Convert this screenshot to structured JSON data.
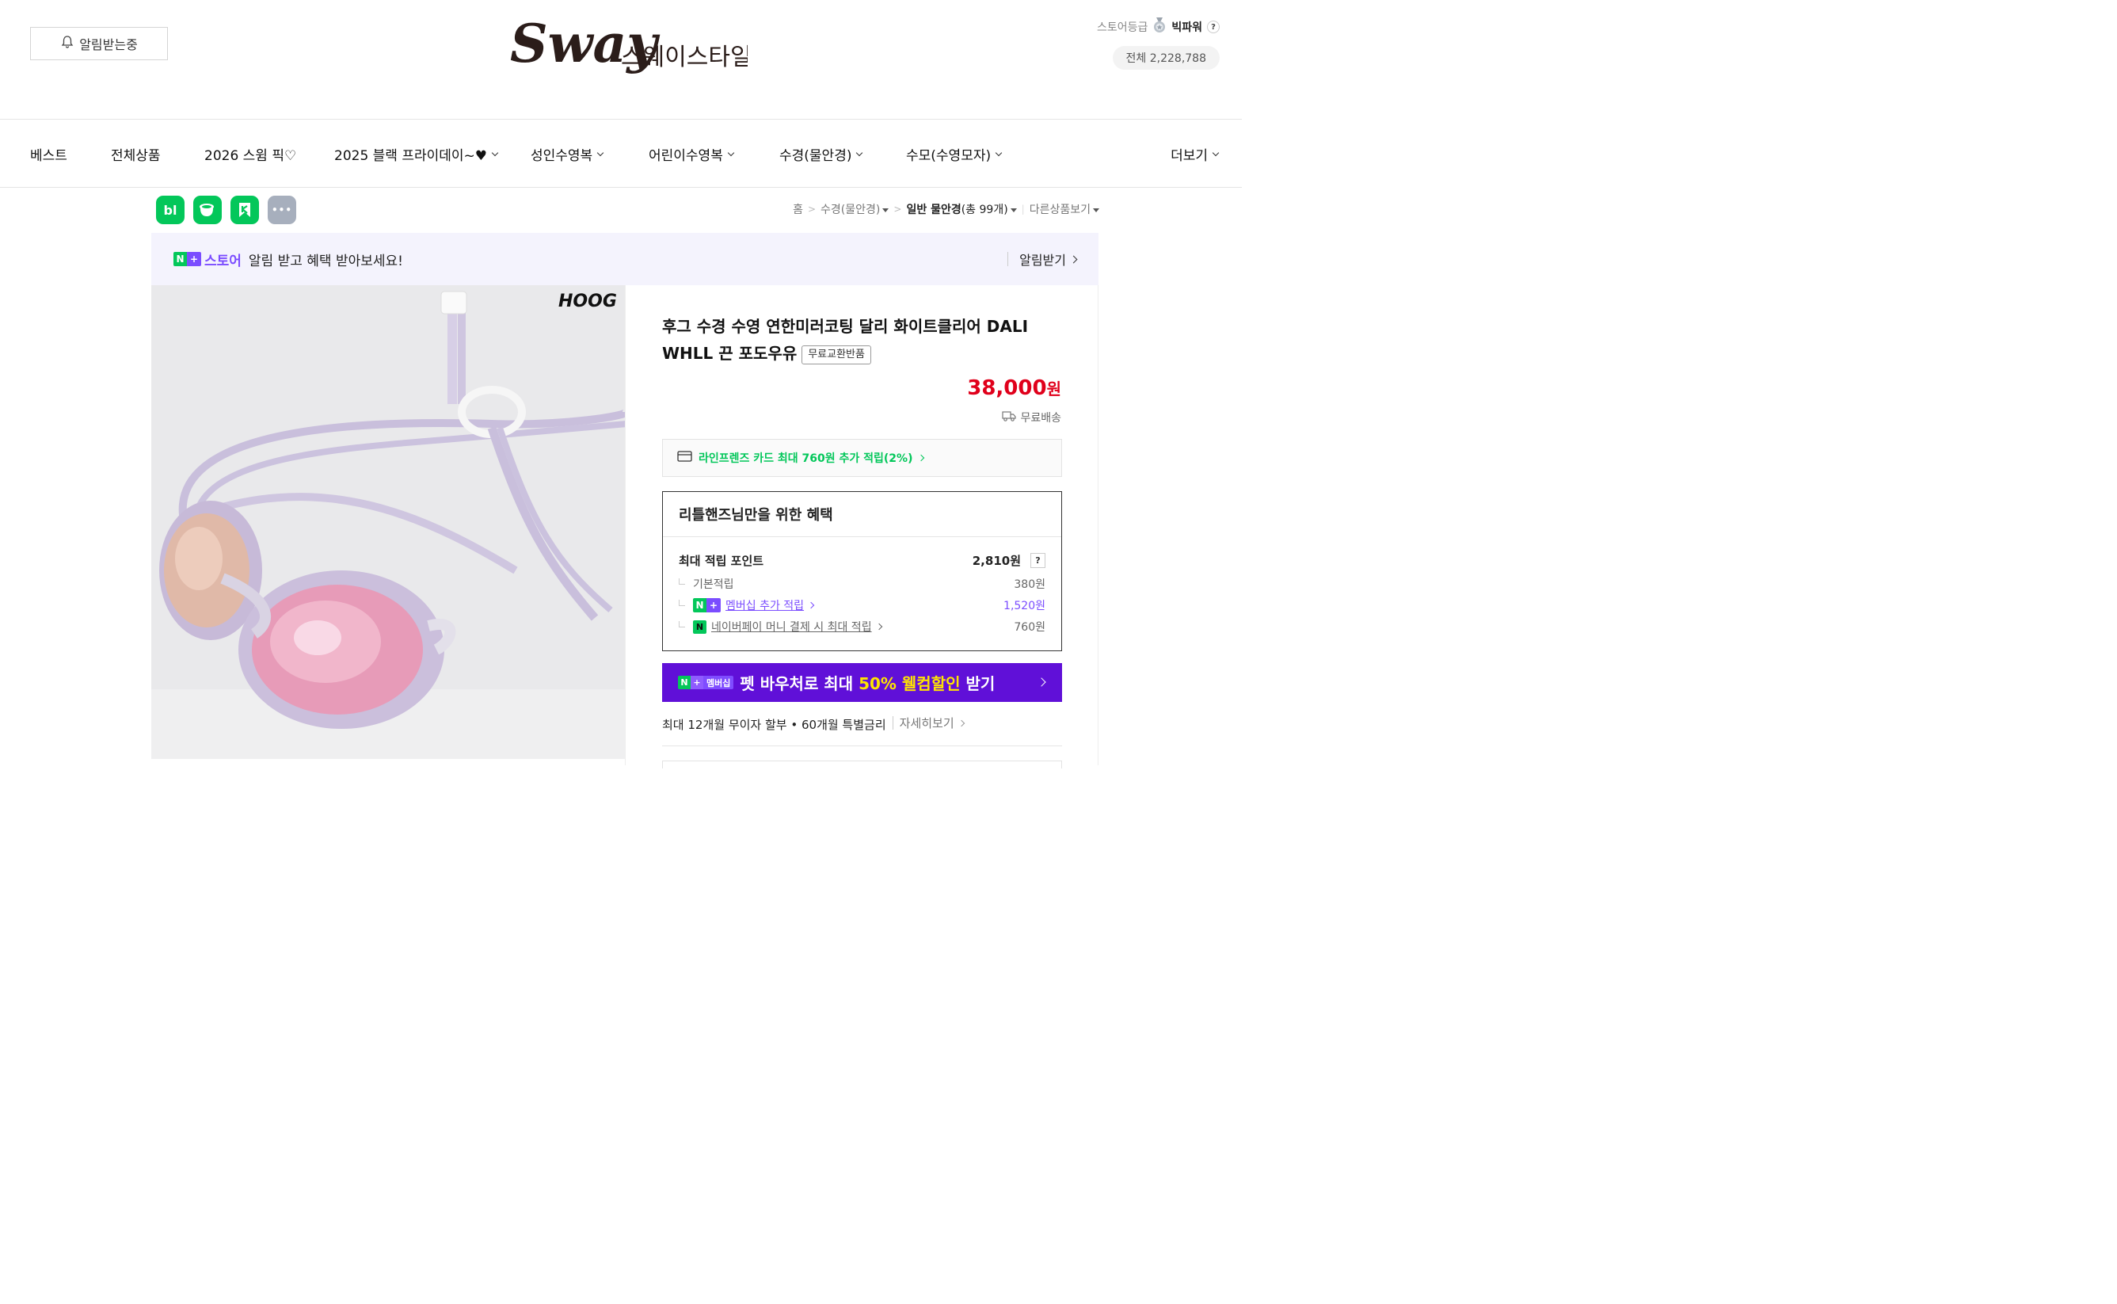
{
  "header": {
    "alarm_button": "알림받는중",
    "logo_text": "Sway",
    "logo_korean": "스웨이스타일",
    "store_grade_label": "스토어등급",
    "store_grade_name": "빅파워",
    "help": "?",
    "total_visits": "전체 2,228,788"
  },
  "nav": {
    "items": [
      {
        "label": "베스트"
      },
      {
        "label": "전체상품"
      },
      {
        "label": "2026 스윔 픽♡"
      },
      {
        "label": "2025 블랙 프라이데이~♥"
      },
      {
        "label": "성인수영복"
      },
      {
        "label": "어린이수영복"
      },
      {
        "label": "수경(물안경)"
      },
      {
        "label": "수모(수영모자)"
      }
    ],
    "more": "더보기"
  },
  "share": {
    "icons": [
      "blog-icon",
      "cafe-icon",
      "keep-icon",
      "more-icon"
    ],
    "blog": "bl",
    "more": "•••"
  },
  "breadcrumb": {
    "home": "홈",
    "level1": "수경(물안경)",
    "level2_prefix": "일반 물안경",
    "level2_count": "(총 99개)",
    "other": "다른상품보기"
  },
  "promo": {
    "store_label": "스토어",
    "text": "알림 받고 혜택 받아보세요!",
    "link": "알림받기"
  },
  "product": {
    "brand_logo": "HOOG",
    "title": "후그 수경 수영 연한미러코팅 달리 화이트클리어 DALI WHLL 끈 포도우유",
    "tag": "무료교환반품",
    "price": "38,000",
    "currency": "원",
    "shipping": "무료배송"
  },
  "card_offer": "라인프렌즈 카드 최대 760원 추가 적립(2%)",
  "benefit": {
    "heading": "리틀핸즈님만을 위한 혜택",
    "max_points_label": "최대 적립 포인트",
    "max_points_value": "2,810원",
    "basic_label": "기본적립",
    "basic_value": "380원",
    "membership_label": "멤버십 추가 적립",
    "membership_value": "1,520원",
    "npay_label": "네이버페이 머니 결제 시 최대 적립",
    "npay_value": "760원"
  },
  "membership_banner": {
    "badge": "멤버십",
    "text_prefix": "펫 바우처로 최대 ",
    "highlight": "50% 웰컴할인",
    "text_suffix": " 받기"
  },
  "installment": {
    "text": "최대 12개월 무이자 할부 • 60개월 특별금리",
    "detail": "자세히보기"
  },
  "colors": {
    "price_red": "#e0001b",
    "naver_green": "#03c75a",
    "naver_purple": "#7b4dff",
    "membership_bg": "#6010d8"
  }
}
